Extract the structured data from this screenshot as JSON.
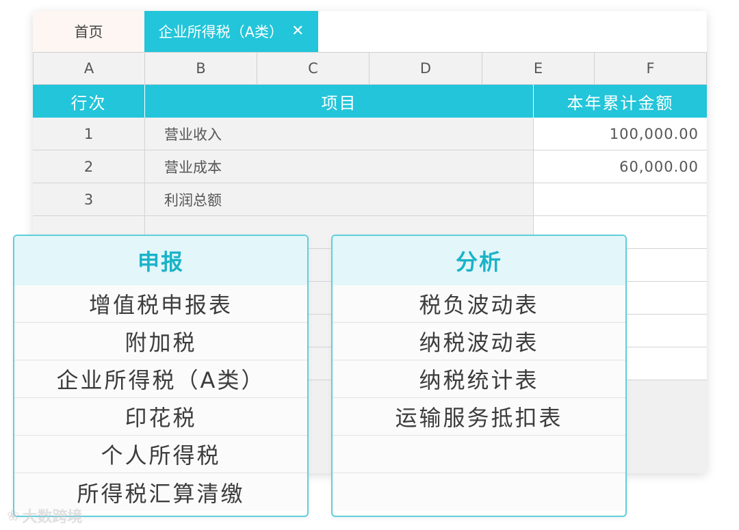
{
  "tabs": {
    "home": "首页",
    "active": "企业所得税（A类）",
    "close_glyph": "✕"
  },
  "columns": [
    "A",
    "B",
    "C",
    "D",
    "E",
    "F"
  ],
  "table": {
    "headers": {
      "row_no": "行次",
      "item": "项目",
      "amount": "本年累计金额"
    },
    "rows": [
      {
        "no": "1",
        "item": "营业收入",
        "amount": "100,000.00"
      },
      {
        "no": "2",
        "item": "营业成本",
        "amount": "60,000.00"
      },
      {
        "no": "3",
        "item": "利润总额",
        "amount": ""
      }
    ]
  },
  "panels": {
    "declare": {
      "title": "申报",
      "items": [
        "增值税申报表",
        "附加税",
        "企业所得税（A类）",
        "印花税",
        "个人所得税",
        "所得税汇算清缴"
      ]
    },
    "analysis": {
      "title": "分析",
      "items": [
        "税负波动表",
        "纳税波动表",
        "纳税统计表",
        "运输服务抵扣表",
        "",
        ""
      ]
    }
  },
  "watermark": {
    "glyph": "❀",
    "text": "大数跨境"
  },
  "colors": {
    "accent": "#22c5d9",
    "panel_border": "#5fcedc",
    "panel_title": "#1ab3c8"
  }
}
